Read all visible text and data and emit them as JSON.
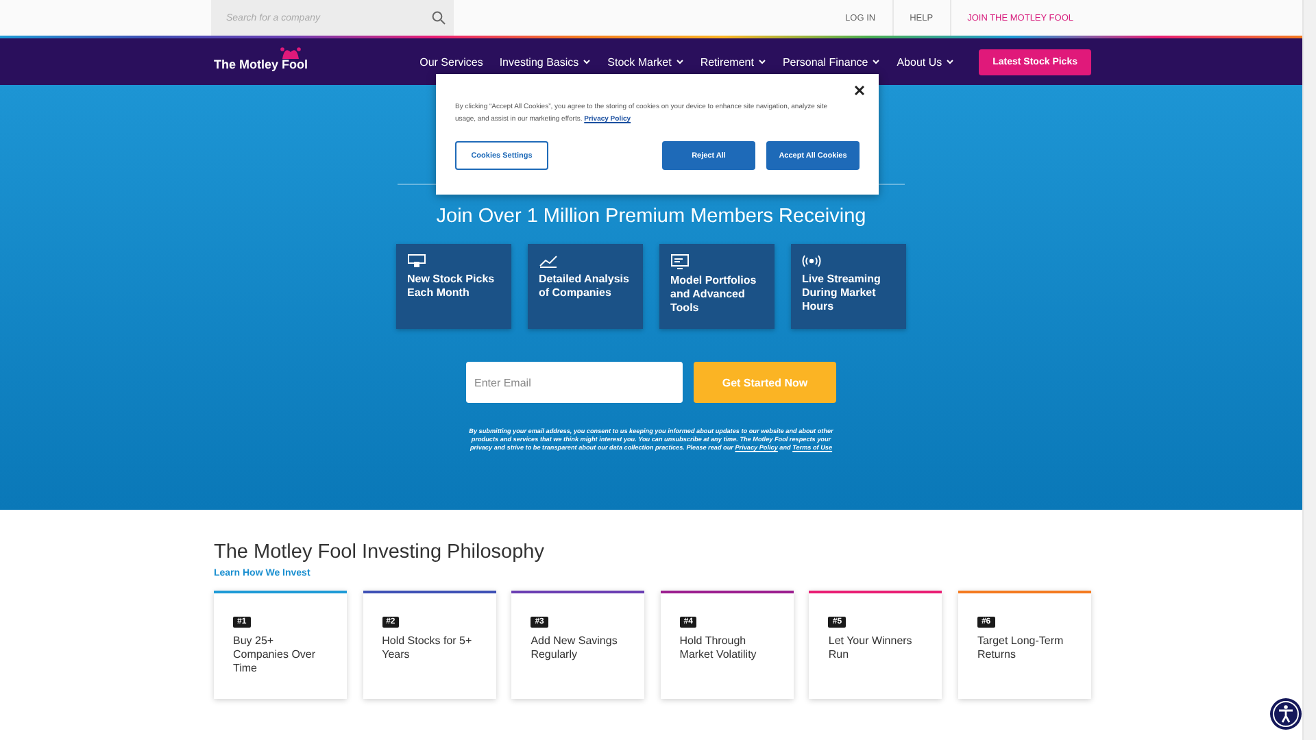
{
  "top_bar": {
    "search": {
      "placeholder": "Search for a company"
    },
    "links": [
      "LOG IN",
      "HELP",
      "JOIN THE MOTLEY FOOL"
    ]
  },
  "nav": {
    "logo": "The Motley Fool",
    "items": [
      {
        "label": "Our Services",
        "has_menu": false
      },
      {
        "label": "Investing Basics",
        "has_menu": true
      },
      {
        "label": "Stock Market",
        "has_menu": true
      },
      {
        "label": "Retirement",
        "has_menu": true
      },
      {
        "label": "Personal Finance",
        "has_menu": true
      },
      {
        "label": "About Us",
        "has_menu": true
      }
    ],
    "cta": "Latest Stock Picks"
  },
  "cookie_banner": {
    "text": "By clicking “Accept All Cookies”, you agree to the storing of cookies on your device to enhance site navigation, analyze site usage, and assist in our marketing efforts.",
    "link": "Privacy Policy",
    "buttons": [
      "Cookies Settings",
      "Reject All",
      "Accept All Cookies"
    ]
  },
  "hero": {
    "headline": "Join Over 1 Million Premium Members Receiving",
    "features": [
      {
        "kind": "picks",
        "label": "New Stock Picks Each Month"
      },
      {
        "kind": "analysis",
        "label": "Detailed Analysis of Companies"
      },
      {
        "kind": "portfolio",
        "label": "Model Portfolios and Advanced Tools"
      },
      {
        "kind": "streaming",
        "label": "Live Streaming During Market Hours"
      }
    ],
    "email": {
      "placeholder": "Enter Email"
    },
    "submit": "Get Started Now",
    "disclaimer": "By submitting your email address, you consent to us keeping you informed about updates to our website and about other products and services that we think might interest you. You can unsubscribe at any time. The Motley Fool respects your privacy and strive to be transparent about our data collection practices. Please read our",
    "disclaimer_links": [
      "Privacy Policy",
      "Terms of Use"
    ],
    "disclaimer_join": "and"
  },
  "philosophy": {
    "title": "The Motley Fool Investing Philosophy",
    "link": "Learn How We Invest",
    "cards": [
      {
        "badge": "#1",
        "text": "Buy 25+ Companies Over Time",
        "color": "#1e9bd7"
      },
      {
        "badge": "#2",
        "text": "Hold Stocks for 5+ Years",
        "color": "#3f51b5"
      },
      {
        "badge": "#3",
        "text": "Add New Savings Regularly",
        "color": "#6b3fb3"
      },
      {
        "badge": "#4",
        "text": "Hold Through Market Volatility",
        "color": "#9c1f8f"
      },
      {
        "badge": "#5",
        "text": "Let Your Winners Run",
        "color": "#e91e74"
      },
      {
        "badge": "#6",
        "text": "Target Long-Term Returns",
        "color": "#f47b20"
      }
    ]
  }
}
